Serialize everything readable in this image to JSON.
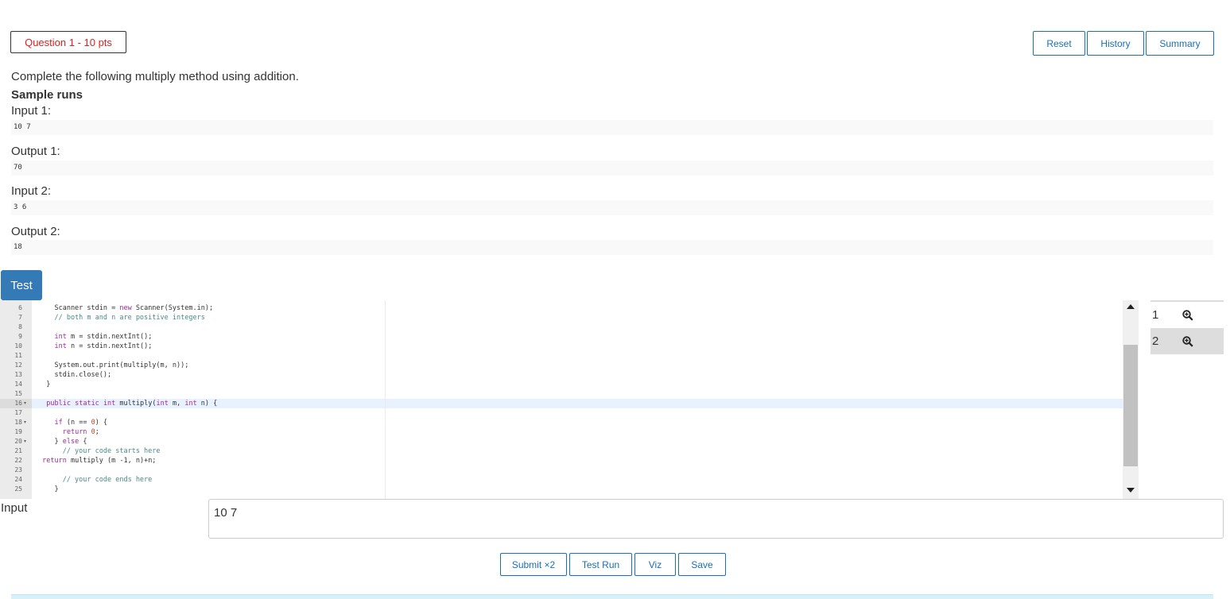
{
  "question": {
    "badge": "Question 1 - 10 pts"
  },
  "toolbar": {
    "reset": "Reset",
    "history": "History",
    "summary": "Summary"
  },
  "problem": {
    "text": "Complete the following multiply method using addition.",
    "section_title": "Sample runs",
    "samples": [
      {
        "label": "Input 1:",
        "value": "10 7"
      },
      {
        "label": "Output 1:",
        "value": "70"
      },
      {
        "label": "Input 2:",
        "value": "3 6"
      },
      {
        "label": "Output 2:",
        "value": "18"
      }
    ]
  },
  "test_button": "Test",
  "editor": {
    "lines": [
      {
        "n": "6",
        "text": "    Scanner stdin = new Scanner(System.in);"
      },
      {
        "n": "7",
        "text": "    // both m and n are positive integers"
      },
      {
        "n": "8",
        "text": ""
      },
      {
        "n": "9",
        "text": "    int m = stdin.nextInt();"
      },
      {
        "n": "10",
        "text": "    int n = stdin.nextInt();"
      },
      {
        "n": "11",
        "text": ""
      },
      {
        "n": "12",
        "text": "    System.out.print(multiply(m, n));"
      },
      {
        "n": "13",
        "text": "    stdin.close();"
      },
      {
        "n": "14",
        "text": "  }"
      },
      {
        "n": "15",
        "text": ""
      },
      {
        "n": "16",
        "text": "  public static int multiply(int m, int n) {"
      },
      {
        "n": "17",
        "text": ""
      },
      {
        "n": "18",
        "text": "    if (n == 0) {"
      },
      {
        "n": "19",
        "text": "      return 0;"
      },
      {
        "n": "20",
        "text": "    } else {"
      },
      {
        "n": "21",
        "text": "      // your code starts here"
      },
      {
        "n": "22",
        "text": " return multiply (m -1, n)+n;"
      },
      {
        "n": "23",
        "text": ""
      },
      {
        "n": "24",
        "text": "      // your code ends here"
      },
      {
        "n": "25",
        "text": "    }"
      }
    ],
    "fold_lines": [
      "16",
      "18",
      "20"
    ]
  },
  "sidebar": {
    "items": [
      {
        "label": "1"
      },
      {
        "label": "2"
      }
    ]
  },
  "input_panel": {
    "label": "Input",
    "value": "10 7"
  },
  "bottom": {
    "submit": "Submit ×2",
    "test_run": "Test Run",
    "viz": "Viz",
    "save": "Save"
  },
  "colors": {
    "badge_text": "#e02020",
    "primary": "#337ab7",
    "link_blue": "#1a6fb5"
  }
}
